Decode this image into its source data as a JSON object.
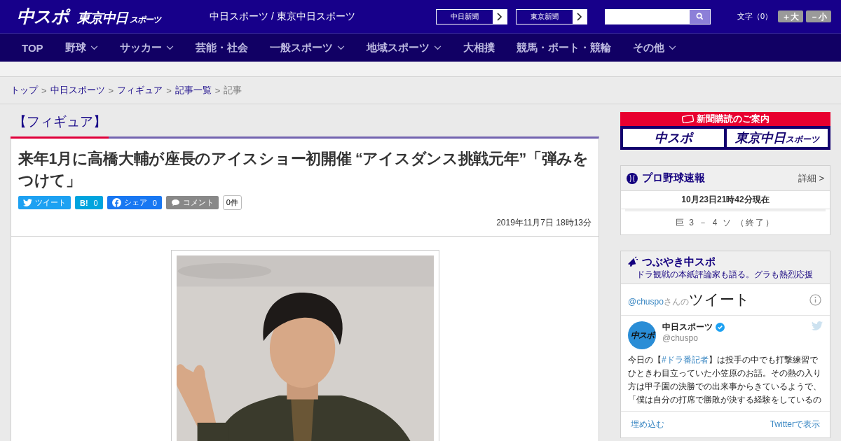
{
  "header": {
    "logo_main": "中スポ",
    "logo_sub": "東京中日",
    "logo_sub_small": "スポーツ",
    "site_title": "中日スポーツ / 東京中日スポーツ",
    "paper_links": [
      {
        "label": "中日新聞"
      },
      {
        "label": "東京新聞"
      }
    ],
    "font_size": {
      "label": "文字（0）",
      "buttons": [
        "＋大",
        "－小"
      ]
    }
  },
  "nav": [
    {
      "label": "TOP",
      "dropdown": false
    },
    {
      "label": "野球",
      "dropdown": true
    },
    {
      "label": "サッカー",
      "dropdown": true
    },
    {
      "label": "芸能・社会",
      "dropdown": false
    },
    {
      "label": "一般スポーツ",
      "dropdown": true
    },
    {
      "label": "地域スポーツ",
      "dropdown": true
    },
    {
      "label": "大相撲",
      "dropdown": false
    },
    {
      "label": "競馬・ボート・競輪",
      "dropdown": false
    },
    {
      "label": "その他",
      "dropdown": true
    }
  ],
  "breadcrumb": [
    {
      "label": "トップ",
      "link": true
    },
    {
      "separator": ">",
      "label": "中日スポーツ",
      "link": true
    },
    {
      "separator": ">",
      "label": "フィギュア",
      "link": true
    },
    {
      "separator": ">",
      "label": "記事一覧",
      "link": true
    },
    {
      "separator": ">",
      "label": "記事",
      "link": false
    }
  ],
  "article": {
    "category": "【フィギュア】",
    "title": "来年1月に高橋大輔が座長のアイスショー初開催 “アイスダンス挑戦元年”「弾みをつけて」",
    "share": [
      {
        "kind": "twitter",
        "label": "ツイート"
      },
      {
        "kind": "hatena",
        "label": "B!",
        "count": "0"
      },
      {
        "kind": "facebook",
        "label": "シェア",
        "count": "0"
      },
      {
        "kind": "comment",
        "label": "コメント",
        "count": "0件"
      }
    ],
    "date": "2019年11月7日 18時13分"
  },
  "sidebar": {
    "subscribe": {
      "title": "新聞購読のご案内",
      "logos": [
        "中スポ",
        "東京中日"
      ],
      "logo_small": "スポーツ"
    },
    "baseball": {
      "title": "プロ野球速報",
      "more": "詳細 >",
      "updated": "10月23日21時42分現在",
      "score": "巨 3 － 4 ソ （終了）"
    },
    "tweets": {
      "title": "つぶやき中スポ",
      "subtitle": "ドラ観戦の本紙評論家も語る。グラも熱烈応援",
      "handle": "@chuspo",
      "handle_suffix": "さんの",
      "heading": "ツイート",
      "tweet": {
        "name": "中日スポーツ",
        "verified": true,
        "user": "@chuspo",
        "avatar_text": "中スポ",
        "text_before": "今日の【",
        "hashtag": "#ドラ番記者",
        "text_after": "】は投手の中でも打撃練習でひときわ目立っていた小笠原のお話。その熱の入り方は甲子園の決勝での出来事からきているようで、「僕は自分の打席で勝敗が決する経験をしているの"
      },
      "embed": "埋め込む",
      "view": "Twitterで表示"
    }
  }
}
